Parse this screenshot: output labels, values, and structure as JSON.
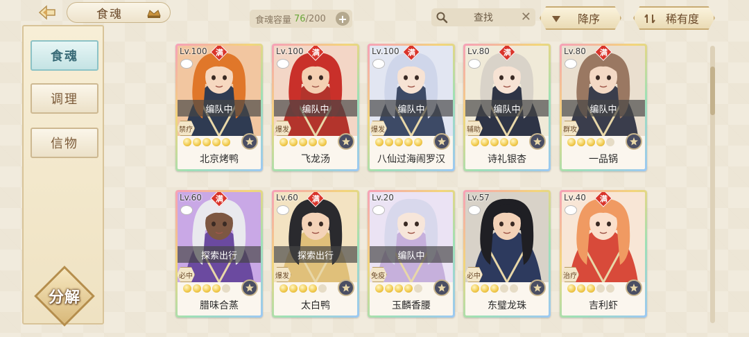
{
  "header": {
    "title": "食魂",
    "capacity_label": "食魂容量",
    "capacity_current": "76",
    "capacity_max": "/200",
    "search_label": "查找",
    "sort_order_label": "降序",
    "sort_key_label": "稀有度"
  },
  "sidebar": {
    "tabs": [
      {
        "label": "食魂",
        "active": true
      },
      {
        "label": "调理",
        "active": false
      },
      {
        "label": "信物",
        "active": false
      }
    ],
    "decompose_label": "分解"
  },
  "cards": [
    {
      "level": "Lv.100",
      "max": "满",
      "status": "编队中",
      "role": "禁疗",
      "stars": 5,
      "name": "北京烤鸭",
      "hair": "#e0772a",
      "skin": "#f6d8c0",
      "robe": "#2f3b52",
      "bg": "#f2c6a0"
    },
    {
      "level": "Lv.100",
      "max": "满",
      "status": "编队中",
      "role": "爆发",
      "stars": 5,
      "name": "飞龙汤",
      "hair": "#c9302a",
      "skin": "#f4cfb2",
      "robe": "#b3342c",
      "bg": "#f3d6c6"
    },
    {
      "level": "Lv.100",
      "max": "满",
      "status": "编队中",
      "role": "爆发",
      "stars": 5,
      "name": "八仙过海闹罗汉",
      "hair": "#cfd6ea",
      "skin": "#f7e3d4",
      "robe": "#3d4a66",
      "bg": "#e2e6f2"
    },
    {
      "level": "Lv.80",
      "max": "满",
      "status": "编队中",
      "role": "辅助",
      "stars": 5,
      "name": "诗礼银杏",
      "hair": "#d9d3c9",
      "skin": "#f7e3d4",
      "robe": "#2e3446",
      "bg": "#f0ead8"
    },
    {
      "level": "Lv.80",
      "max": "满",
      "status": "编队中",
      "role": "群攻",
      "stars": 4,
      "name": "一品锅",
      "hair": "#9a7862",
      "skin": "#f4d9c5",
      "robe": "#3a3d4c",
      "bg": "#eadfcf"
    },
    {
      "level": "Lv.60",
      "max": "满",
      "status": "探索出行",
      "role": "必中",
      "stars": 4,
      "name": "腊味合蒸",
      "hair": "#e9e9ee",
      "skin": "#7d5742",
      "robe": "#6b4aa0",
      "bg": "#c9a8e6"
    },
    {
      "level": "Lv.60",
      "max": "满",
      "status": "探索出行",
      "role": "爆发",
      "stars": 4,
      "name": "太白鸭",
      "hair": "#2a2a2e",
      "skin": "#f4d3b8",
      "robe": "#e0c07a",
      "bg": "#f3e3c2"
    },
    {
      "level": "Lv.20",
      "max": "",
      "status": "编队中",
      "role": "免疫",
      "stars": 4,
      "name": "玉麟香腰",
      "hair": "#d8d8ec",
      "skin": "#f7e6da",
      "robe": "#c6b0dc",
      "bg": "#ebe3f4"
    },
    {
      "level": "Lv.57",
      "max": "",
      "status": "",
      "role": "必中",
      "stars": 3,
      "name": "东璧龙珠",
      "hair": "#1f1f24",
      "skin": "#f3d2b8",
      "robe": "#2d3a5e",
      "bg": "#d8d2c8"
    },
    {
      "level": "Lv.40",
      "max": "满",
      "status": "",
      "role": "治疗",
      "stars": 3,
      "name": "吉利虾",
      "hair": "#f09a62",
      "skin": "#fbe0cc",
      "robe": "#d84a3a",
      "bg": "#f8e6d6"
    }
  ],
  "colors": {
    "accent_teal": "#8bc2c6",
    "badge_red": "#d9342b",
    "capacity_green": "#6aa638"
  },
  "icons": [
    "back-arrow-icon",
    "chef-hat-icon",
    "plus-icon",
    "search-icon",
    "clear-icon",
    "sort-down-icon",
    "sort-filter-icon",
    "bowl-icon",
    "star-seal-icon"
  ]
}
